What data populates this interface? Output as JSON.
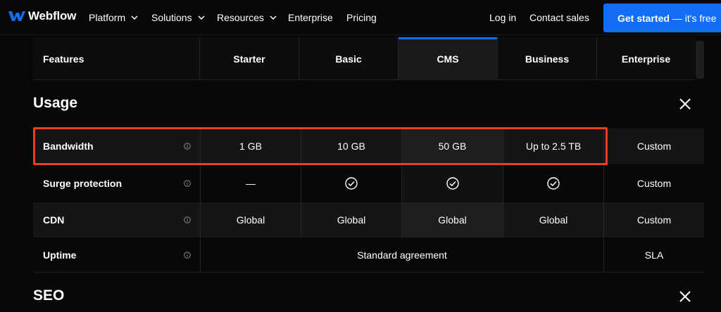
{
  "nav": {
    "brand": "Webflow",
    "items": [
      {
        "label": "Platform",
        "dropdown": true
      },
      {
        "label": "Solutions",
        "dropdown": true
      },
      {
        "label": "Resources",
        "dropdown": true
      },
      {
        "label": "Enterprise",
        "dropdown": false
      },
      {
        "label": "Pricing",
        "dropdown": false
      }
    ],
    "login": "Log in",
    "contact": "Contact sales",
    "cta": "Get started",
    "cta_suffix": "— it's free"
  },
  "plans": {
    "features_label": "Features",
    "columns": [
      "Starter",
      "Basic",
      "CMS",
      "Business",
      "Enterprise"
    ],
    "active": "CMS"
  },
  "sections": [
    {
      "title": "Usage",
      "rows": [
        {
          "feature": "Bandwidth",
          "values": [
            "1 GB",
            "10 GB",
            "50 GB",
            "Up to 2.5 TB",
            "Custom"
          ]
        },
        {
          "feature": "Surge protection",
          "values": [
            "—",
            "check-icon",
            "check-icon",
            "check-icon",
            "Custom"
          ]
        },
        {
          "feature": "CDN",
          "values": [
            "Global",
            "Global",
            "Global",
            "Global",
            "Custom"
          ]
        },
        {
          "feature": "Uptime",
          "merged_value": "Standard agreement",
          "enterprise_value": "SLA"
        }
      ]
    },
    {
      "title": "SEO"
    }
  ],
  "colors": {
    "accent": "#146ef5",
    "highlight": "#e8411f",
    "background": "#080808"
  }
}
